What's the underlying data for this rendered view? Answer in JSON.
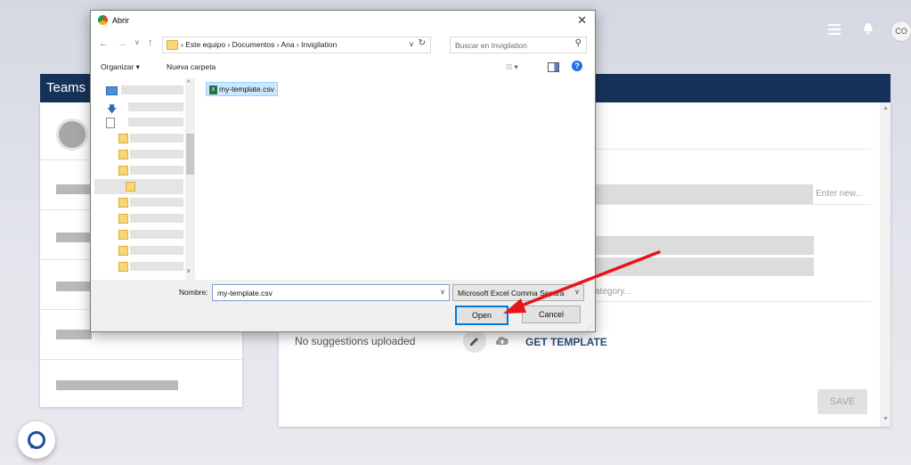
{
  "app": {
    "teams_title": "Teams",
    "avatar_initials": "CO",
    "field_placeholder": "Enter new...",
    "category_hint": "ategory...",
    "suggestions_status": "No suggestions uploaded",
    "get_template_label": "GET TEMPLATE",
    "save_label": "SAVE"
  },
  "dialog": {
    "title": "Abrir",
    "breadcrumb": [
      "Este equipo",
      "Documentos",
      "Ana",
      "Invigilation"
    ],
    "search_placeholder": "Buscar en Invigilation",
    "toolbar": {
      "organize_label": "Organizar ▾",
      "new_folder_label": "Nueva carpeta"
    },
    "files": [
      {
        "name": "my-template.csv",
        "selected": true
      }
    ],
    "filename_label": "Nombre:",
    "filename_value": "my-template.csv",
    "filetype_value": "Microsoft Excel Comma Separa",
    "open_label": "Open",
    "cancel_label": "Cancel"
  },
  "colors": {
    "header_navy": "#17325a",
    "accent_blue": "#2d4e7c",
    "annotation_red": "#e8141a",
    "selection_bg": "#cce8ff"
  }
}
